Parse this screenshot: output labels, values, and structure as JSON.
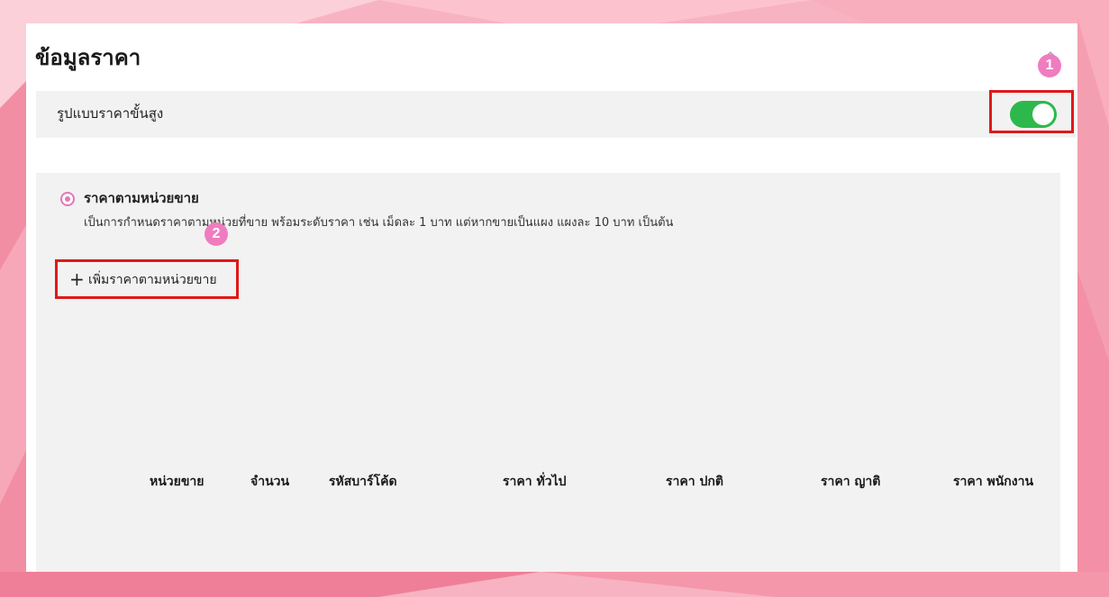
{
  "section": {
    "title": "ข้อมูลราคา",
    "collapse_icon": "chevron-up-icon"
  },
  "advanced_pricing": {
    "label": "รูปแบบราคาขั้นสูง",
    "enabled": true,
    "toggle_color": "#2db84c"
  },
  "annotations": {
    "badge1": "1",
    "badge2": "2",
    "highlight_color": "#e01818",
    "badge_color": "#f07cc0"
  },
  "unit_pricing": {
    "option_title": "ราคาตามหน่วยขาย",
    "selected": true,
    "description": "เป็นการกำหนดราคาตามหน่วยที่ขาย พร้อมระดับราคา เช่น เม็ดละ 1 บาท แต่หากขายเป็นแผง แผงละ 10 บาท เป็นต้น",
    "add_button_label": "เพิ่มราคาตามหน่วยขาย",
    "add_icon": "plus-icon"
  },
  "table": {
    "columns": [
      "หน่วยขาย",
      "จำนวน",
      "รหัสบาร์โค้ด",
      "ราคา ทั่วไป",
      "ราคา ปกติ",
      "ราคา ญาติ",
      "ราคา พนักงาน"
    ]
  }
}
